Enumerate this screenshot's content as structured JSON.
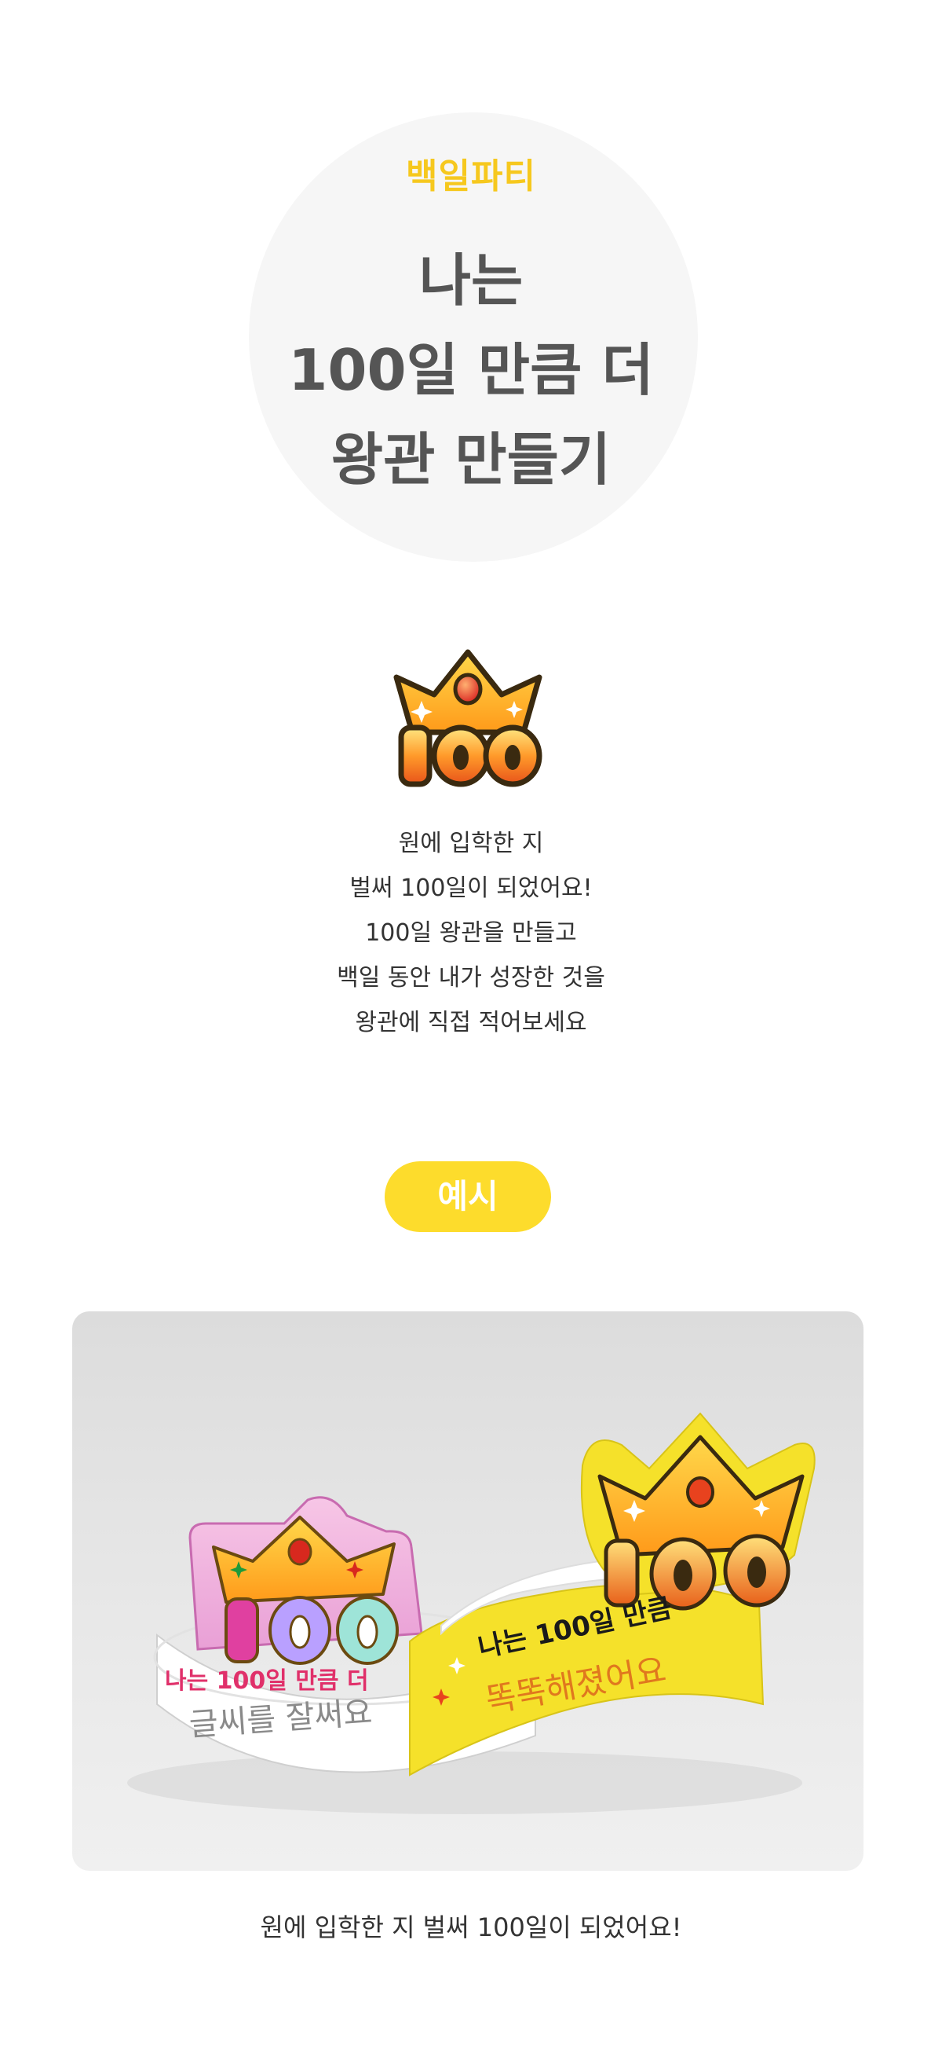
{
  "hero": {
    "eyebrow": "백일파티",
    "title_lines": [
      "나는",
      "100일 만큼 더",
      "왕관 만들기"
    ]
  },
  "crown_icon": {
    "number": "100"
  },
  "intro": {
    "lines": [
      "원에 입학한 지",
      "벌써 100일이 되었어요!",
      "100일 왕관을 만들고",
      "백일 동안 내가 성장한 것을",
      "왕관에 직접 적어보세요"
    ]
  },
  "example": {
    "badge": "예시"
  },
  "photo": {
    "left_crown": {
      "number": "100",
      "printed": "나는 100일 만큼 더",
      "handwriting": "글씨를 잘써요"
    },
    "right_crown": {
      "number": "100",
      "printed": "나는 100일 만큼",
      "handwriting": "똑똑해졌어요"
    }
  },
  "caption": "원에 입학한 지 벌써 100일이 되었어요!",
  "colors": {
    "accent_yellow": "#fddc2c",
    "eyebrow_yellow": "#f6c81e",
    "circle_bg": "#f6f6f6",
    "title_gray": "#555555"
  }
}
